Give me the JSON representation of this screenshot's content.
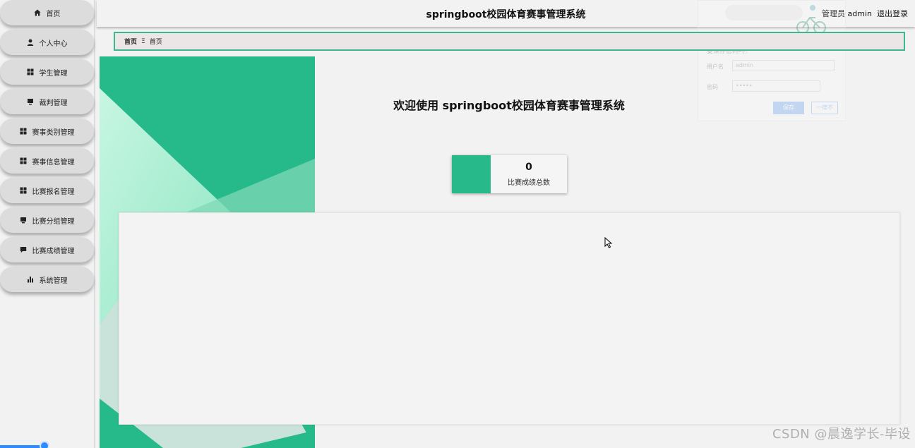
{
  "app": {
    "title": "springboot校园体育赛事管理系统"
  },
  "user": {
    "role_label": "管理员 admin",
    "logout_label": "退出登录"
  },
  "sidebar": {
    "items": [
      {
        "label": "首页",
        "icon": "home-icon"
      },
      {
        "label": "个人中心",
        "icon": "person-icon"
      },
      {
        "label": "学生管理",
        "icon": "grid-icon"
      },
      {
        "label": "裁判管理",
        "icon": "monitor-icon"
      },
      {
        "label": "赛事类别管理",
        "icon": "grid-icon"
      },
      {
        "label": "赛事信息管理",
        "icon": "grid-icon"
      },
      {
        "label": "比赛报名管理",
        "icon": "grid-icon"
      },
      {
        "label": "比赛分组管理",
        "icon": "monitor-icon"
      },
      {
        "label": "比赛成绩管理",
        "icon": "comment-icon"
      },
      {
        "label": "系统管理",
        "icon": "bar-chart-icon"
      }
    ]
  },
  "breadcrumb": {
    "home": "首页",
    "separator": "Ξ",
    "current": "首页"
  },
  "main": {
    "welcome": "欢迎使用 springboot校园体育赛事管理系统"
  },
  "stat": {
    "value": "0",
    "label": "比赛成绩总数"
  },
  "ghost_dialog": {
    "question": "要保存密码吗？",
    "username_label": "用户名",
    "username_value": "admin",
    "password_label": "密码",
    "password_value": "•••••",
    "save_label": "保存",
    "never_label": "一律不"
  },
  "watermark": "CSDN @晨逸学长-毕设",
  "colors": {
    "accent": "#27b98a",
    "breadcrumb_border": "#3db88e",
    "slider": "#2e8bff"
  }
}
